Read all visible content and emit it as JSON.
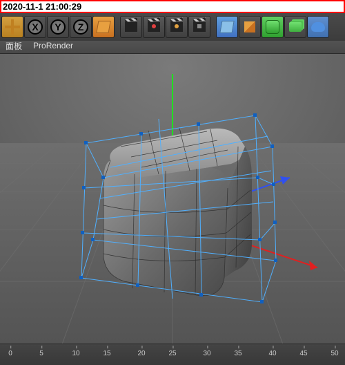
{
  "timestamp": "2020-11-1 21:00:29",
  "toolbar": {
    "move": "Move",
    "x": "X",
    "y": "Y",
    "z": "Z"
  },
  "menu": {
    "panel": "面板",
    "prorender": "ProRender"
  },
  "timeline": {
    "ticks": [
      "0",
      "5",
      "10",
      "15",
      "20",
      "25",
      "30",
      "35",
      "40",
      "45",
      "50"
    ]
  }
}
